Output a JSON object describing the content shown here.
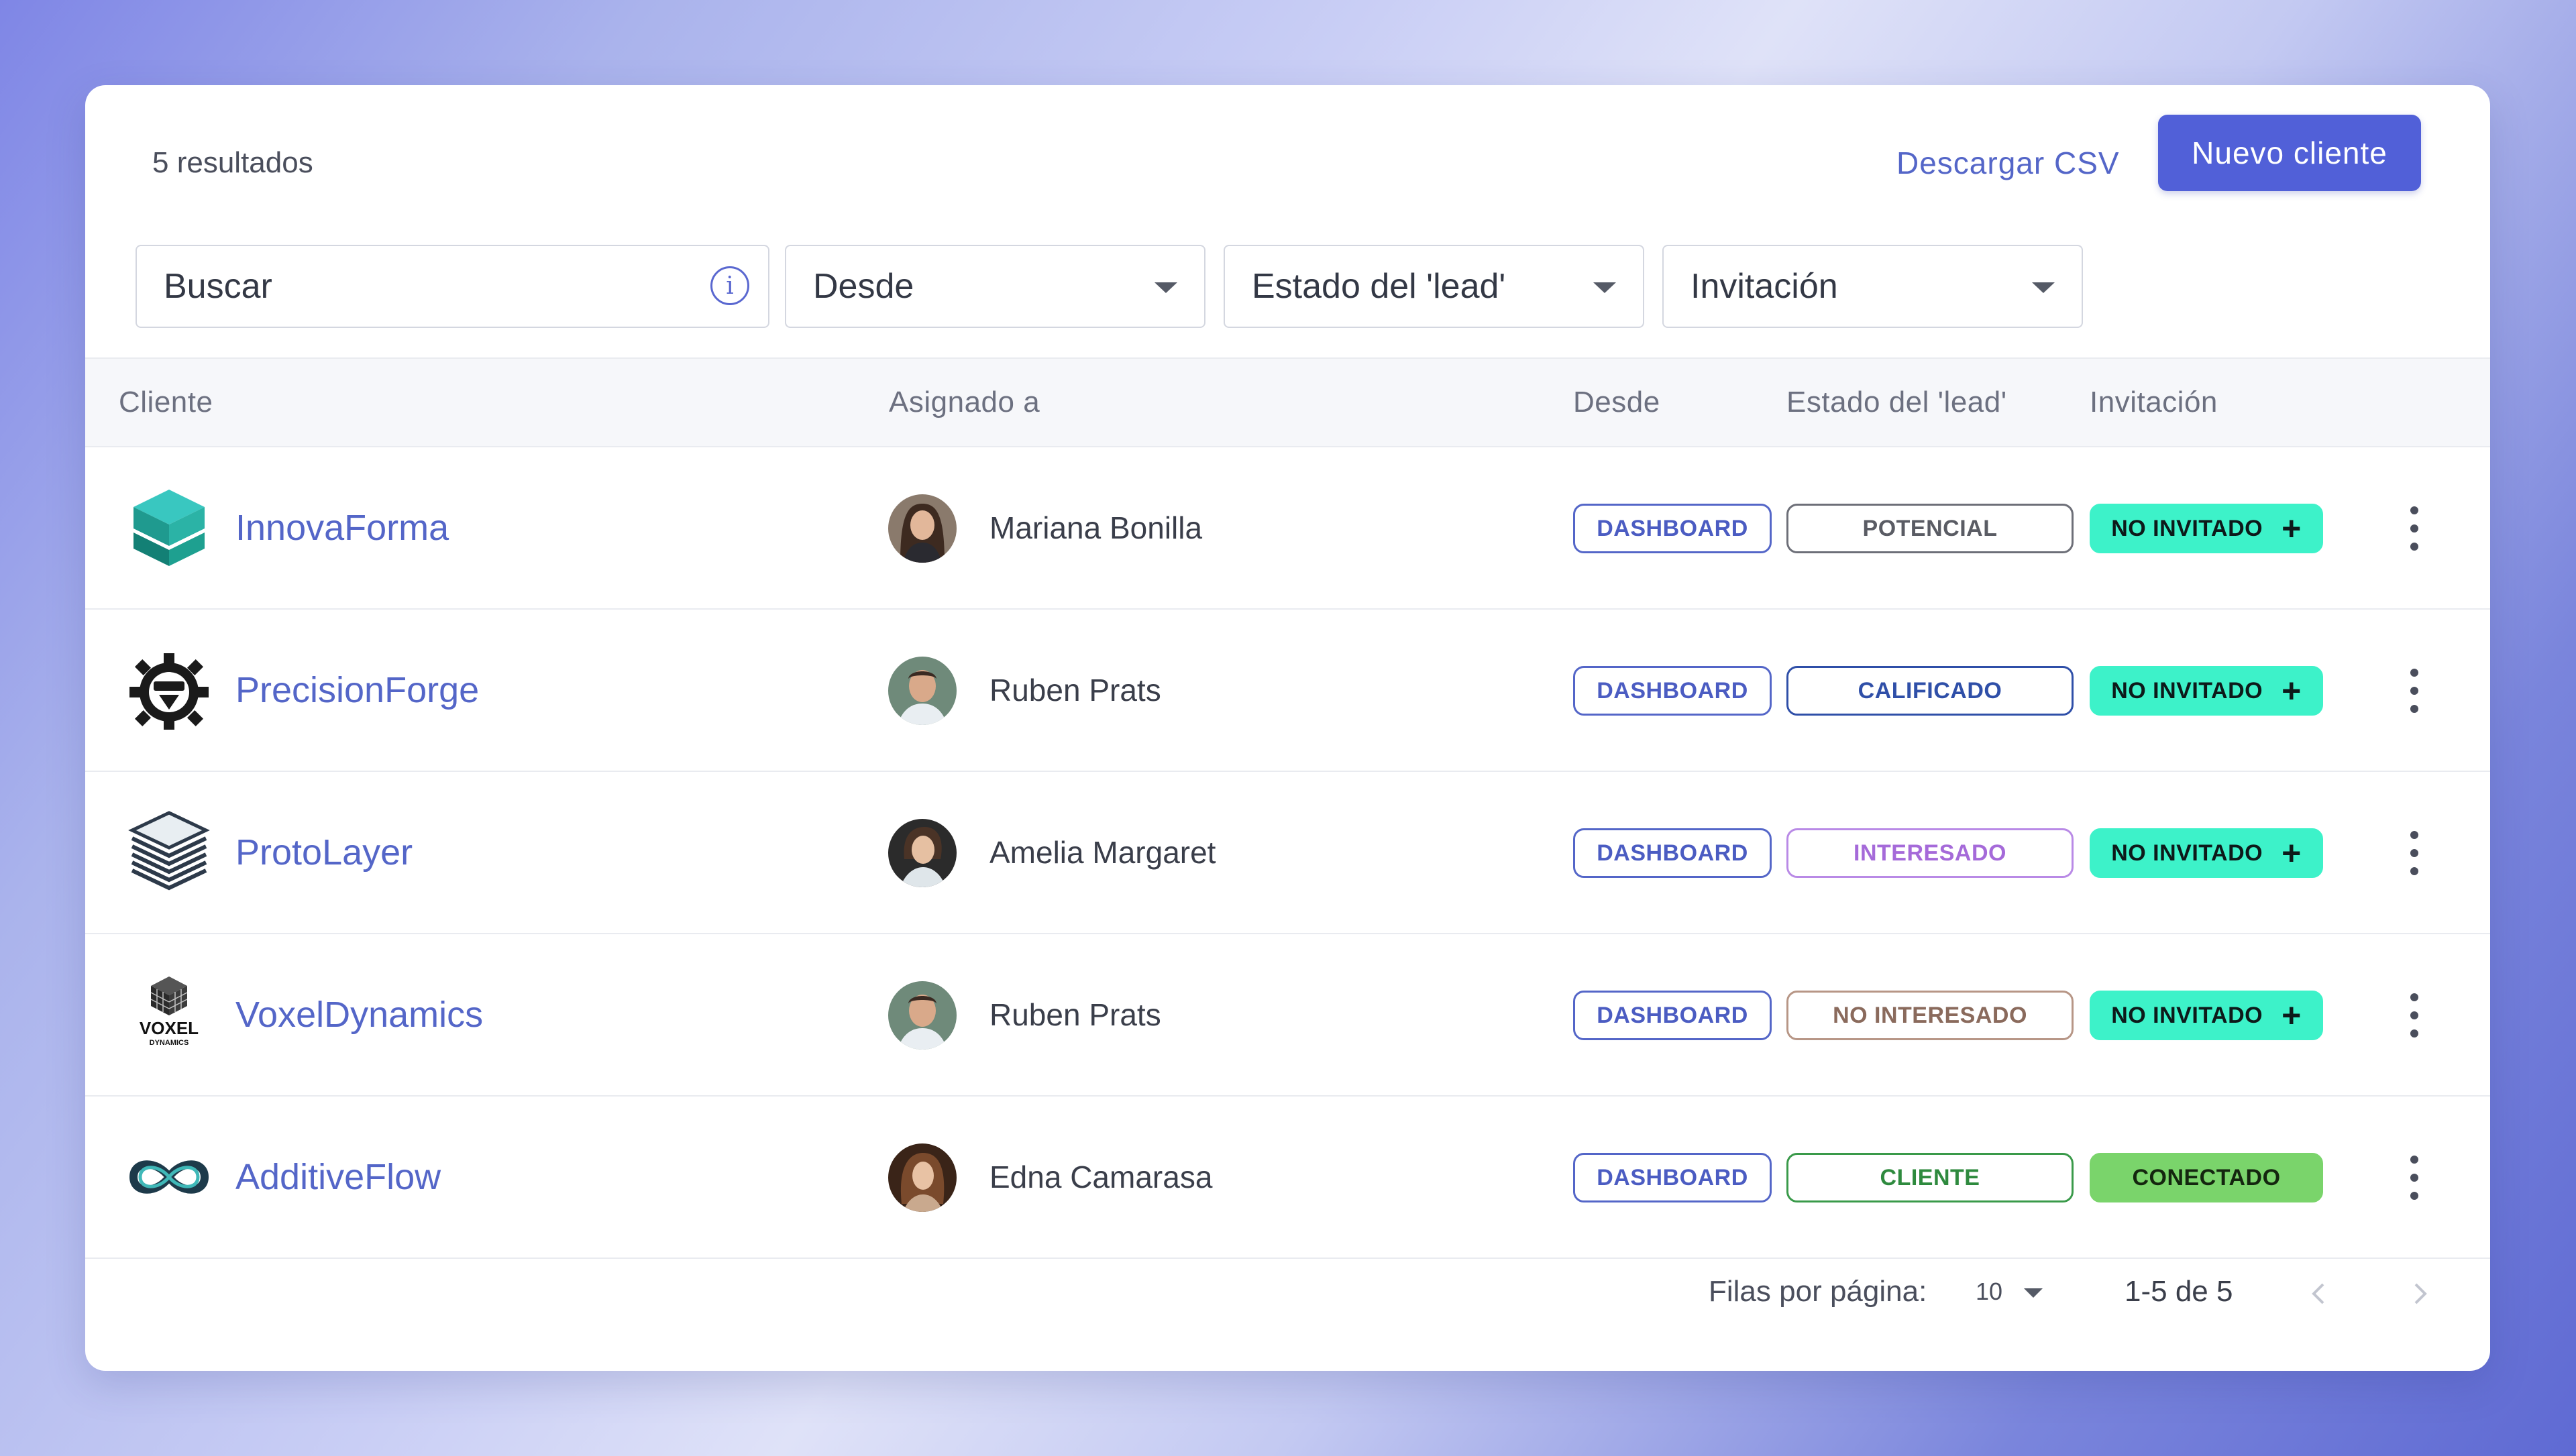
{
  "header": {
    "results_text": "5 resultados",
    "download_csv_label": "Descargar CSV",
    "new_client_label": "Nuevo cliente"
  },
  "filters": {
    "search_placeholder": "Buscar",
    "source_label": "Desde",
    "lead_status_label": "Estado del 'lead'",
    "invitation_label": "Invitación"
  },
  "table": {
    "columns": [
      "Cliente",
      "Asignado a",
      "Desde",
      "Estado del 'lead'",
      "Invitación"
    ],
    "rows": [
      {
        "client": "InnovaForma",
        "logo": "green-cube-stack-logo",
        "assignee": "Mariana Bonilla",
        "source": "DASHBOARD",
        "lead_status": "POTENCIAL",
        "invitation": "NO INVITADO"
      },
      {
        "client": "PrecisionForge",
        "logo": "gear-face-logo",
        "assignee": "Ruben Prats",
        "source": "DASHBOARD",
        "lead_status": "CALIFICADO",
        "invitation": "NO INVITADO"
      },
      {
        "client": "ProtoLayer",
        "logo": "layered-stack-logo",
        "assignee": "Amelia Margaret",
        "source": "DASHBOARD",
        "lead_status": "INTERESADO",
        "invitation": "NO INVITADO"
      },
      {
        "client": "VoxelDynamics",
        "logo": "voxel-cube-logo",
        "logo_text": "VOXEL",
        "logo_subtext": "DYNAMICS",
        "assignee": "Ruben Prats",
        "source": "DASHBOARD",
        "lead_status": "NO INTERESADO",
        "invitation": "NO INVITADO"
      },
      {
        "client": "AdditiveFlow",
        "logo": "infinity-loop-logo",
        "assignee": "Edna Camarasa",
        "source": "DASHBOARD",
        "lead_status": "CLIENTE",
        "invitation": "CONECTADO"
      }
    ]
  },
  "pagination": {
    "rows_per_page_label": "Filas por página:",
    "rows_per_page_value": "10",
    "range_text": "1-5 de 5"
  },
  "colors": {
    "accent": "#5160d8",
    "link": "#5466c8",
    "invite": "#3df2c9",
    "connected": "#7ad46b",
    "status_potencial": "#6d6f78",
    "status_calificado": "#2f4fa8",
    "status_interesado": "#a56ad9",
    "status_no_interesado": "#8a6a5c",
    "status_cliente": "#2e8a3e"
  }
}
